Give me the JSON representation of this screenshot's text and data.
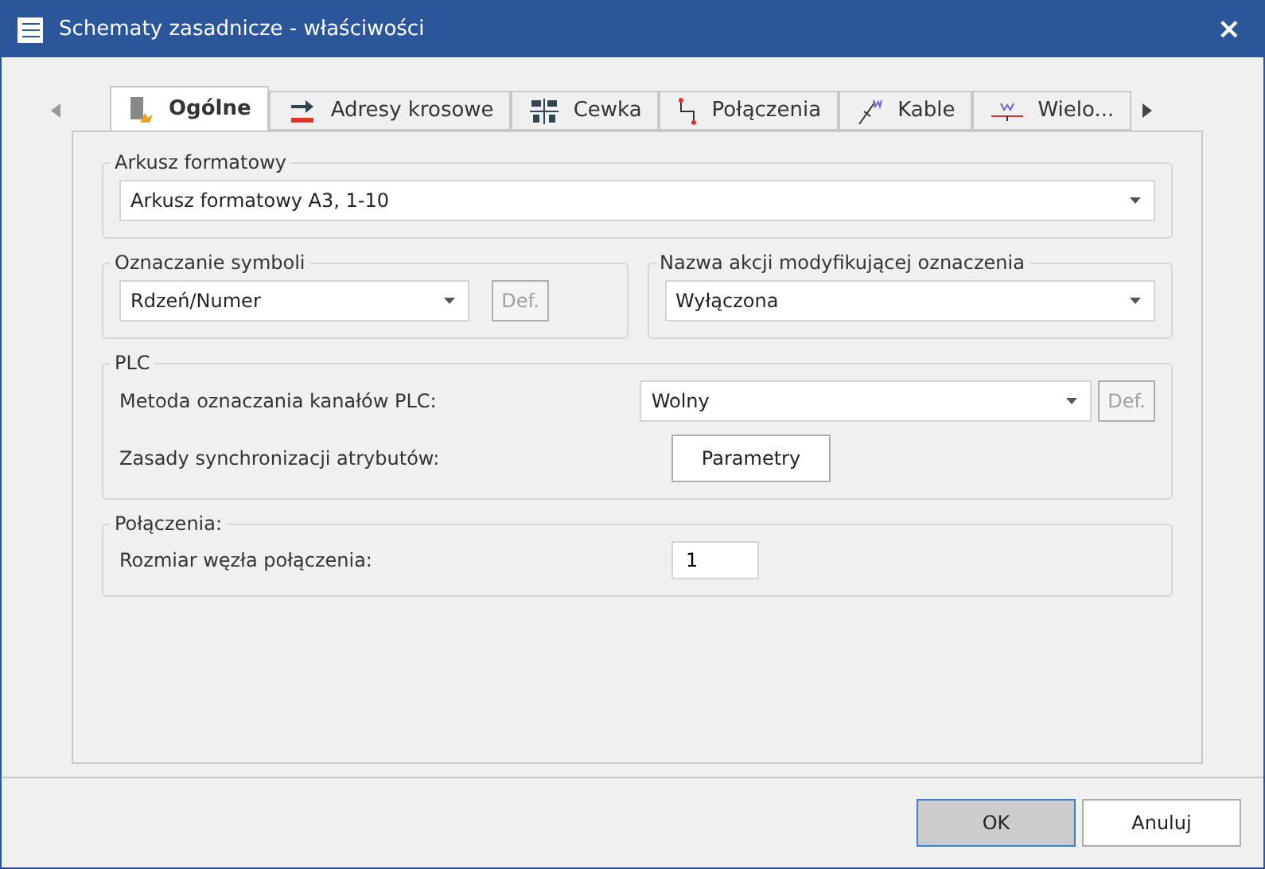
{
  "window": {
    "title": "Schematy zasadnicze - właściwości",
    "close": "×"
  },
  "tabs": [
    {
      "label": "Ogólne",
      "selected": true
    },
    {
      "label": "Adresy krosowe",
      "selected": false
    },
    {
      "label": "Cewka",
      "selected": false
    },
    {
      "label": "Połączenia",
      "selected": false
    },
    {
      "label": "Kable",
      "selected": false
    },
    {
      "label": "Wielo...",
      "selected": false
    }
  ],
  "sheet_format": {
    "legend": "Arkusz formatowy",
    "value": "Arkusz formatowy A3, 1-10"
  },
  "symbol_marking": {
    "legend": "Oznaczanie symboli",
    "value": "Rdzeń/Numer",
    "button": {
      "label": "Def.",
      "disabled": true
    }
  },
  "modify_action": {
    "legend": "Nazwa akcji modyfikującej oznaczenia",
    "value": "Wyłączona"
  },
  "plc": {
    "legend": "PLC",
    "method_label": "Metoda oznaczania kanałów PLC:",
    "method_value": "Wolny",
    "method_button": {
      "label": "Def.",
      "disabled": true
    },
    "sync_label": "Zasady synchronizacji atrybutów:",
    "sync_button": "Parametry"
  },
  "connections": {
    "legend": "Połączenia:",
    "node_size_label": "Rozmiar węzła połączenia:",
    "node_size_value": "1"
  },
  "buttons": [
    {
      "label": "OK",
      "default": true
    },
    {
      "label": "Anuluj",
      "default": false
    }
  ]
}
